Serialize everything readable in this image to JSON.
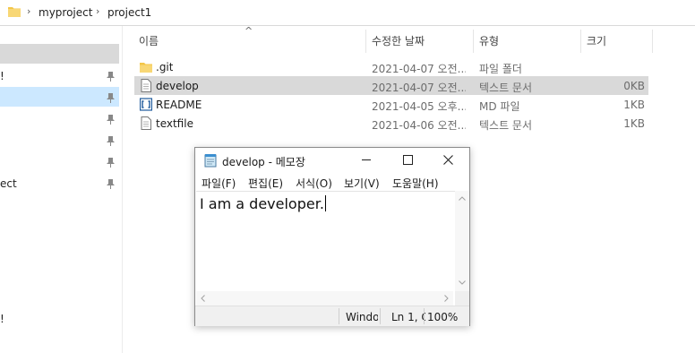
{
  "breadcrumb": {
    "items": [
      "myproject",
      "project1"
    ]
  },
  "nav": {
    "fragments": [
      "!",
      "ect",
      "!"
    ]
  },
  "columns": {
    "name": "이름",
    "date": "수정한 날짜",
    "type": "유형",
    "size": "크기"
  },
  "files": [
    {
      "name": ".git",
      "date": "2021-04-07 오전...",
      "type": "파일 폴더",
      "size": "",
      "icon": "folder-icon"
    },
    {
      "name": "develop",
      "date": "2021-04-07 오전...",
      "type": "텍스트 문서",
      "size": "0KB",
      "icon": "text-file-icon",
      "selected": true
    },
    {
      "name": "README",
      "date": "2021-04-05 오후...",
      "type": "MD 파일",
      "size": "1KB",
      "icon": "md-file-icon"
    },
    {
      "name": "textfile",
      "date": "2021-04-06 오전...",
      "type": "텍스트 문서",
      "size": "1KB",
      "icon": "text-file-icon"
    }
  ],
  "notepad": {
    "title": "develop - 메모장",
    "menu": [
      "파일(F)",
      "편집(E)",
      "서식(O)",
      "보기(V)",
      "도움말(H)"
    ],
    "content": "I am a developer.",
    "status": {
      "encoding": "Windo",
      "position": "Ln 1, C",
      "zoom": "100%"
    }
  }
}
